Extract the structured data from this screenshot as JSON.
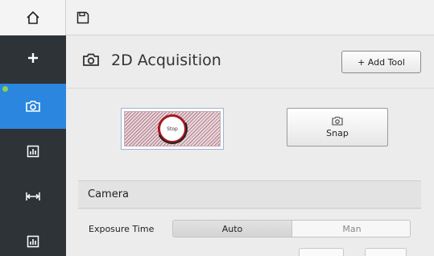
{
  "header": {
    "title": "2D Acquisition",
    "add_tool_label": "+ Add Tool"
  },
  "acquisition": {
    "stop_label": "Stop",
    "snap_label": "Snap"
  },
  "camera": {
    "title": "Camera",
    "exposure_label": "Exposure Time",
    "mode_options": [
      "Auto",
      "Man"
    ],
    "selected_mode": "Auto"
  },
  "icons": {
    "topbar": [
      "home-icon",
      "save-icon"
    ],
    "sidebar": [
      "plus-icon",
      "camera-icon",
      "chart-icon",
      "measure-icon",
      "chart-icon"
    ]
  },
  "colors": {
    "sidebar_bg": "#2e3338",
    "active_accent": "#2b86e0",
    "status_dot": "#8bd14c",
    "stop_ring": "#a61a1a"
  }
}
